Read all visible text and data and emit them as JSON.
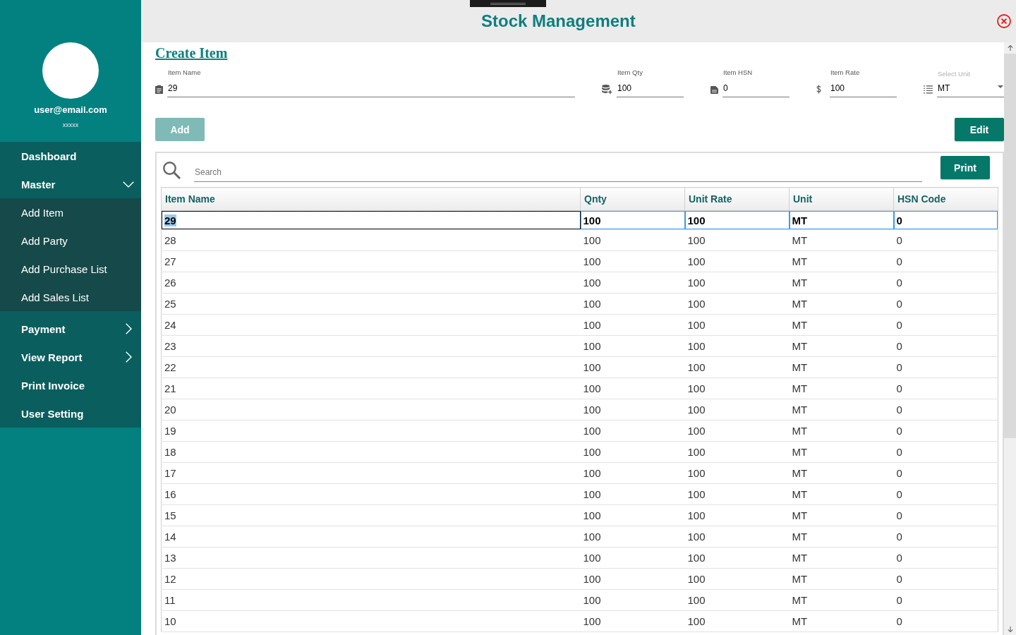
{
  "window": {
    "title": "Stock Management"
  },
  "profile": {
    "email": "user@email.com",
    "subtitle": "xxxxx"
  },
  "sidebar": {
    "items": [
      {
        "label": "Dashboard",
        "kind": "link"
      },
      {
        "label": "Master",
        "kind": "group",
        "expanded": true,
        "children": [
          {
            "label": "Add Item"
          },
          {
            "label": "Add Party"
          },
          {
            "label": "Add Purchase List"
          },
          {
            "label": "Add Sales List"
          }
        ]
      },
      {
        "label": "Payment",
        "kind": "group",
        "expanded": false
      },
      {
        "label": "View Report",
        "kind": "group",
        "expanded": false
      },
      {
        "label": "Print Invoice",
        "kind": "link"
      },
      {
        "label": "User Setting",
        "kind": "link"
      }
    ]
  },
  "form": {
    "title": "Create Item",
    "fields": [
      {
        "label": "Item Name",
        "value": "29",
        "kind": "text"
      },
      {
        "label": "Item Qty",
        "value": "100",
        "kind": "text"
      },
      {
        "label": "Item HSN",
        "value": "0",
        "kind": "text"
      },
      {
        "label": "Item Rate",
        "value": "100",
        "kind": "text"
      },
      {
        "label": "Select Unit",
        "value": "MT",
        "kind": "select"
      }
    ],
    "buttons": [
      {
        "label": "Add",
        "disabled": true
      },
      {
        "label": "Edit",
        "disabled": false
      }
    ]
  },
  "table": {
    "search": {
      "placeholder": "Search"
    },
    "print_button": "Print",
    "columns": [
      "Item Name",
      "Qnty",
      "Unit Rate",
      "Unit",
      "HSN Code"
    ],
    "rows": [
      {
        "cells": [
          "29",
          "100",
          "100",
          "MT",
          "0"
        ],
        "selected": true
      },
      {
        "cells": [
          "28",
          "100",
          "100",
          "MT",
          "0"
        ],
        "selected": false
      },
      {
        "cells": [
          "27",
          "100",
          "100",
          "MT",
          "0"
        ],
        "selected": false
      },
      {
        "cells": [
          "26",
          "100",
          "100",
          "MT",
          "0"
        ],
        "selected": false
      },
      {
        "cells": [
          "25",
          "100",
          "100",
          "MT",
          "0"
        ],
        "selected": false
      },
      {
        "cells": [
          "24",
          "100",
          "100",
          "MT",
          "0"
        ],
        "selected": false
      },
      {
        "cells": [
          "23",
          "100",
          "100",
          "MT",
          "0"
        ],
        "selected": false
      },
      {
        "cells": [
          "22",
          "100",
          "100",
          "MT",
          "0"
        ],
        "selected": false
      },
      {
        "cells": [
          "21",
          "100",
          "100",
          "MT",
          "0"
        ],
        "selected": false
      },
      {
        "cells": [
          "20",
          "100",
          "100",
          "MT",
          "0"
        ],
        "selected": false
      },
      {
        "cells": [
          "19",
          "100",
          "100",
          "MT",
          "0"
        ],
        "selected": false
      },
      {
        "cells": [
          "18",
          "100",
          "100",
          "MT",
          "0"
        ],
        "selected": false
      },
      {
        "cells": [
          "17",
          "100",
          "100",
          "MT",
          "0"
        ],
        "selected": false
      },
      {
        "cells": [
          "16",
          "100",
          "100",
          "MT",
          "0"
        ],
        "selected": false
      },
      {
        "cells": [
          "15",
          "100",
          "100",
          "MT",
          "0"
        ],
        "selected": false
      },
      {
        "cells": [
          "14",
          "100",
          "100",
          "MT",
          "0"
        ],
        "selected": false
      },
      {
        "cells": [
          "13",
          "100",
          "100",
          "MT",
          "0"
        ],
        "selected": false
      },
      {
        "cells": [
          "12",
          "100",
          "100",
          "MT",
          "0"
        ],
        "selected": false
      },
      {
        "cells": [
          "11",
          "100",
          "100",
          "MT",
          "0"
        ],
        "selected": false
      },
      {
        "cells": [
          "10",
          "100",
          "100",
          "MT",
          "0"
        ],
        "selected": false
      }
    ]
  }
}
